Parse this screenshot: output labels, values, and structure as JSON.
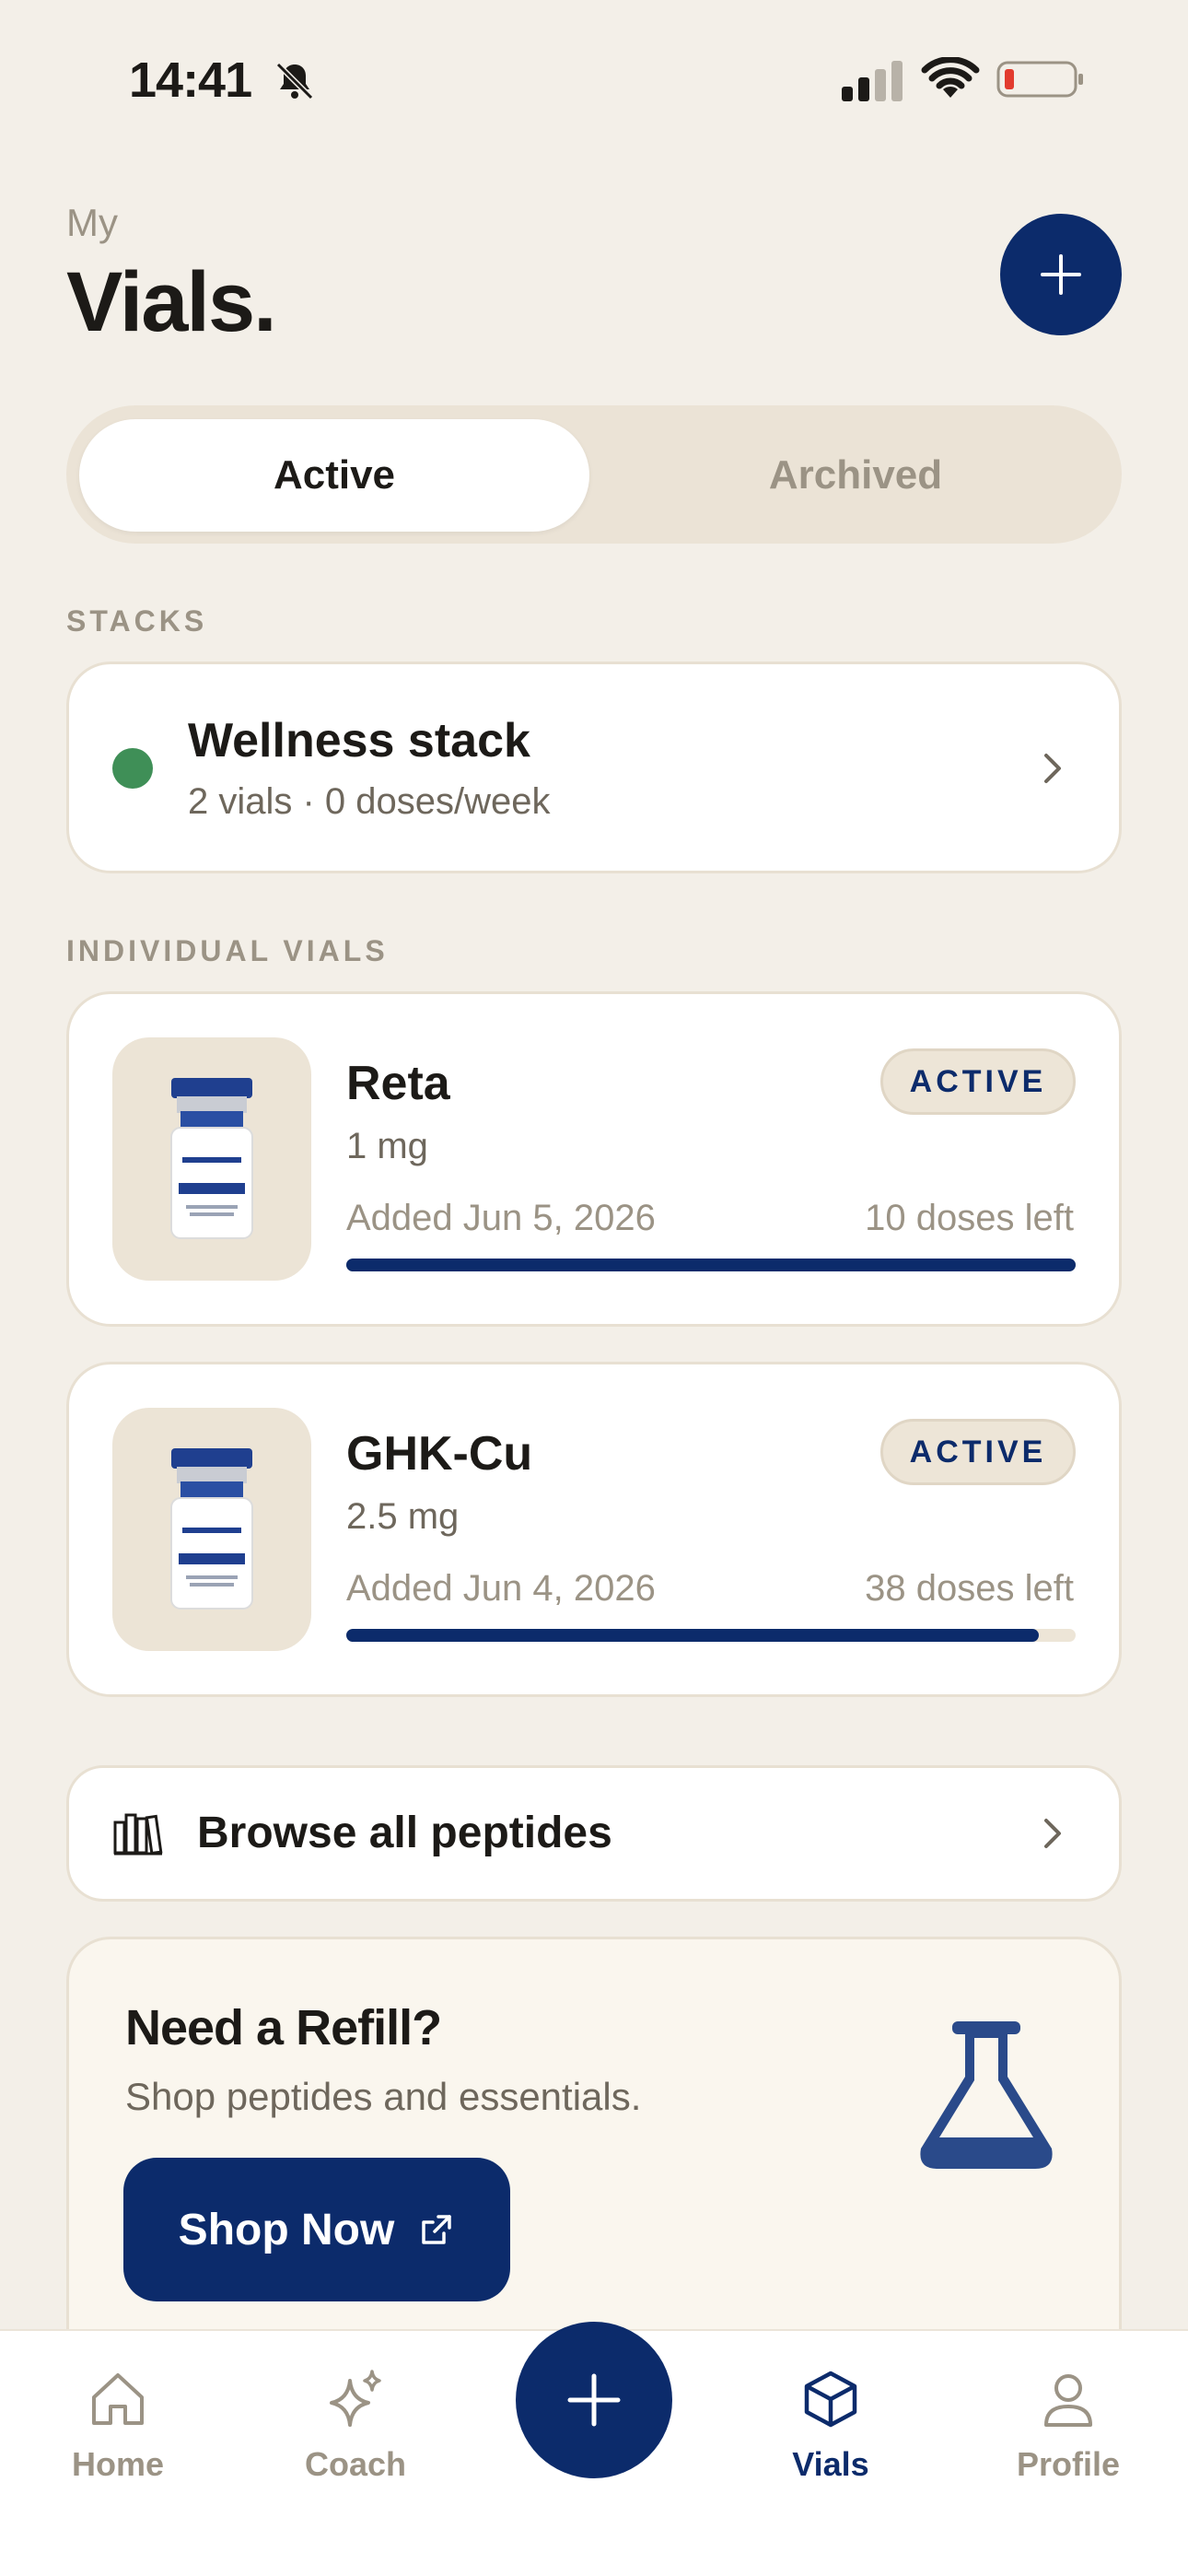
{
  "status_bar": {
    "time": "14:41"
  },
  "header": {
    "eyebrow": "My",
    "title": "Vials."
  },
  "segments": {
    "active": "Active",
    "archived": "Archived"
  },
  "stacks": {
    "section_label": "STACKS",
    "items": [
      {
        "title": "Wellness stack",
        "subtitle": "2 vials · 0 doses/week",
        "status_color": "#3f8f57"
      }
    ]
  },
  "vials": {
    "section_label": "INDIVIDUAL VIALS",
    "items": [
      {
        "name": "Reta",
        "dose": "1 mg",
        "added": "Added Jun 5, 2026",
        "doses_left": "10 doses left",
        "badge": "ACTIVE",
        "progress": 1.0
      },
      {
        "name": "GHK-Cu",
        "dose": "2.5 mg",
        "added": "Added Jun 4, 2026",
        "doses_left": "38 doses left",
        "badge": "ACTIVE",
        "progress": 0.95
      }
    ]
  },
  "browse": {
    "label": "Browse all peptides",
    "icon": "books-icon"
  },
  "refill": {
    "title": "Need a Refill?",
    "subtitle": "Shop peptides and essentials.",
    "button_label": "Shop Now",
    "icon": "flask-icon"
  },
  "tabbar": {
    "items": [
      {
        "label": "Home",
        "icon": "home-icon",
        "active": false
      },
      {
        "label": "Coach",
        "icon": "sparkle-icon",
        "active": false
      },
      {
        "label": "Vials",
        "icon": "cube-icon",
        "active": true
      },
      {
        "label": "Profile",
        "icon": "person-icon",
        "active": false
      }
    ]
  },
  "colors": {
    "accent": "#0c2b6b",
    "background": "#f3efe8",
    "muted": "#9b9385"
  }
}
